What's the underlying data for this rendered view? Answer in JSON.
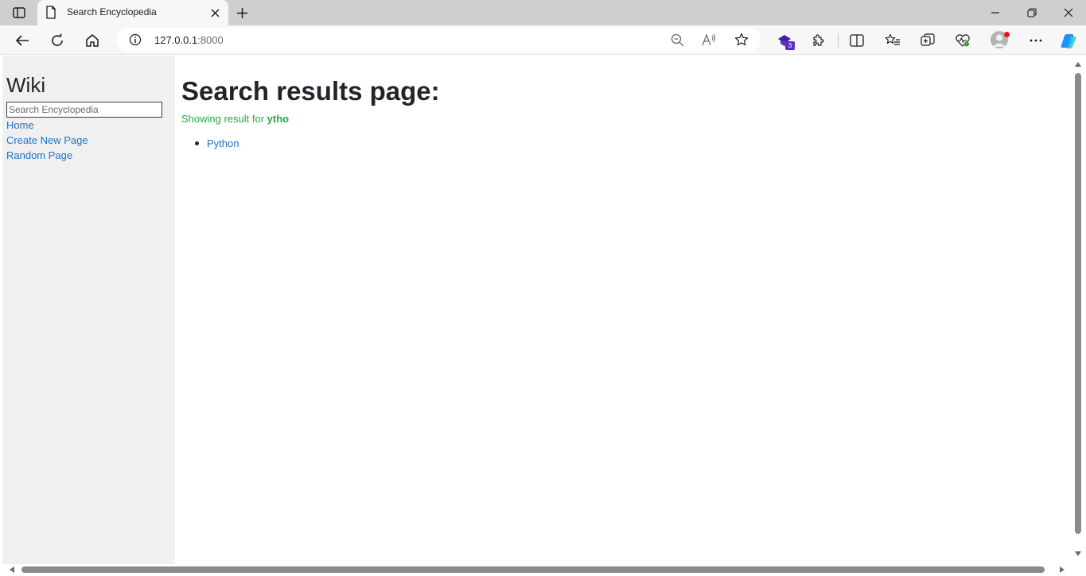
{
  "browser": {
    "tab_title": "Search Encyclopedia",
    "url_host": "127.0.0.1",
    "url_port": ":8000",
    "extension_badge_count": "3",
    "icons": [
      "sidebar-toggle-icon",
      "page-icon",
      "close-icon",
      "plus-icon",
      "minimize-icon",
      "restore-icon",
      "window-close-icon",
      "back-icon",
      "refresh-icon",
      "home-icon",
      "info-icon",
      "zoom-out-icon",
      "read-aloud-icon",
      "favorite-star-icon",
      "extension-badge-icon",
      "puzzle-icon",
      "split-screen-icon",
      "favorites-icon",
      "collections-icon",
      "browser-essentials-icon",
      "profile-avatar",
      "more-icon",
      "copilot-icon"
    ]
  },
  "sidebar": {
    "title": "Wiki",
    "search_placeholder": "Search Encyclopedia",
    "links": [
      "Home",
      "Create New Page",
      "Random Page"
    ]
  },
  "main": {
    "heading": "Search results page:",
    "result_prefix": "Showing result for ",
    "query": "ytho",
    "results": [
      "Python"
    ]
  },
  "colors": {
    "link": "#1a73c9",
    "result_text": "#28a745",
    "sidebar_bg": "#f0f0f0",
    "tabstrip_bg": "#cfcfcf"
  }
}
